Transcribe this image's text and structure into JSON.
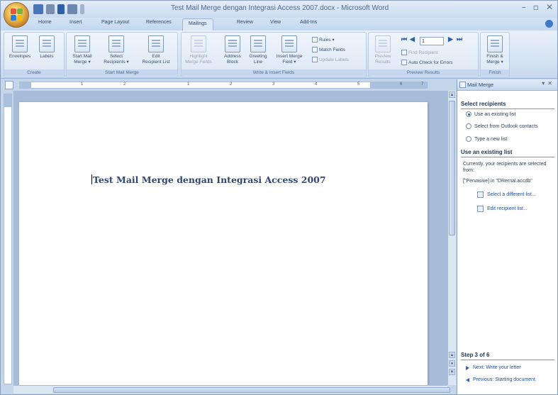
{
  "app": {
    "title": "Test Mail Merge dengan Integrasi Access 2007.docx - Microsoft Word"
  },
  "window_controls": [
    "–",
    "▫",
    "✕"
  ],
  "tabs": [
    {
      "label": "Home",
      "active": false
    },
    {
      "label": "Insert",
      "active": false
    },
    {
      "label": "Page Layout",
      "active": false
    },
    {
      "label": "References",
      "active": false
    },
    {
      "label": "Mailings",
      "active": true
    },
    {
      "label": "Review",
      "active": false
    },
    {
      "label": "View",
      "active": false
    },
    {
      "label": "Add-Ins",
      "active": false
    }
  ],
  "ribbon": {
    "create": {
      "title": "Create",
      "envelopes": "Envelopes",
      "labels": "Labels"
    },
    "start_mail_merge": {
      "title": "Start Mail Merge",
      "start": [
        "Start Mail",
        "Merge ▾"
      ],
      "select_recipients": [
        "Select",
        "Recipients ▾"
      ],
      "edit_list": [
        "Edit",
        "Recipient List"
      ]
    },
    "write_insert": {
      "title": "Write & Insert Fields",
      "highlight": [
        "Highlight",
        "Merge Fields"
      ],
      "address_block": [
        "Address",
        "Block"
      ],
      "greeting_line": [
        "Greeting",
        "Line"
      ],
      "insert_field": [
        "Insert Merge",
        "Field ▾"
      ],
      "rules": "Rules ▾",
      "match_fields": "Match Fields",
      "update_labels": "Update Labels"
    },
    "preview": {
      "title": "Preview Results",
      "preview_btn": [
        "Preview",
        "Results"
      ],
      "record_number": "1",
      "find_recipient": "Find Recipient",
      "auto_check": "Auto Check for Errors"
    },
    "finish": {
      "title": "Finish",
      "finish_btn": [
        "Finish &",
        "Merge ▾"
      ]
    }
  },
  "document": {
    "text": "Test Mail Merge dengan Integrasi Access 2007"
  },
  "pane": {
    "title": "Mail Merge",
    "select_recipients": {
      "title": "Select recipients",
      "options": [
        {
          "label": "Use an existing list",
          "selected": true
        },
        {
          "label": "Select from Outlook contacts",
          "selected": false
        },
        {
          "label": "Type a new list",
          "selected": false
        }
      ]
    },
    "use_existing": {
      "title": "Use an existing list",
      "description": "Currently, your recipients are selected from:",
      "source": "[\"Pervasive] in \"DRernal.accdb\"",
      "select_link": "Select a different list...",
      "edit_link": "Edit recipient list..."
    },
    "step": {
      "label": "Step 3 of 6",
      "next": "Next: Write your letter",
      "previous": "Previous: Starting document"
    }
  },
  "ruler_numbers": [
    "1",
    "2",
    "1",
    "2",
    "3",
    "4",
    "5",
    "6",
    "7"
  ]
}
